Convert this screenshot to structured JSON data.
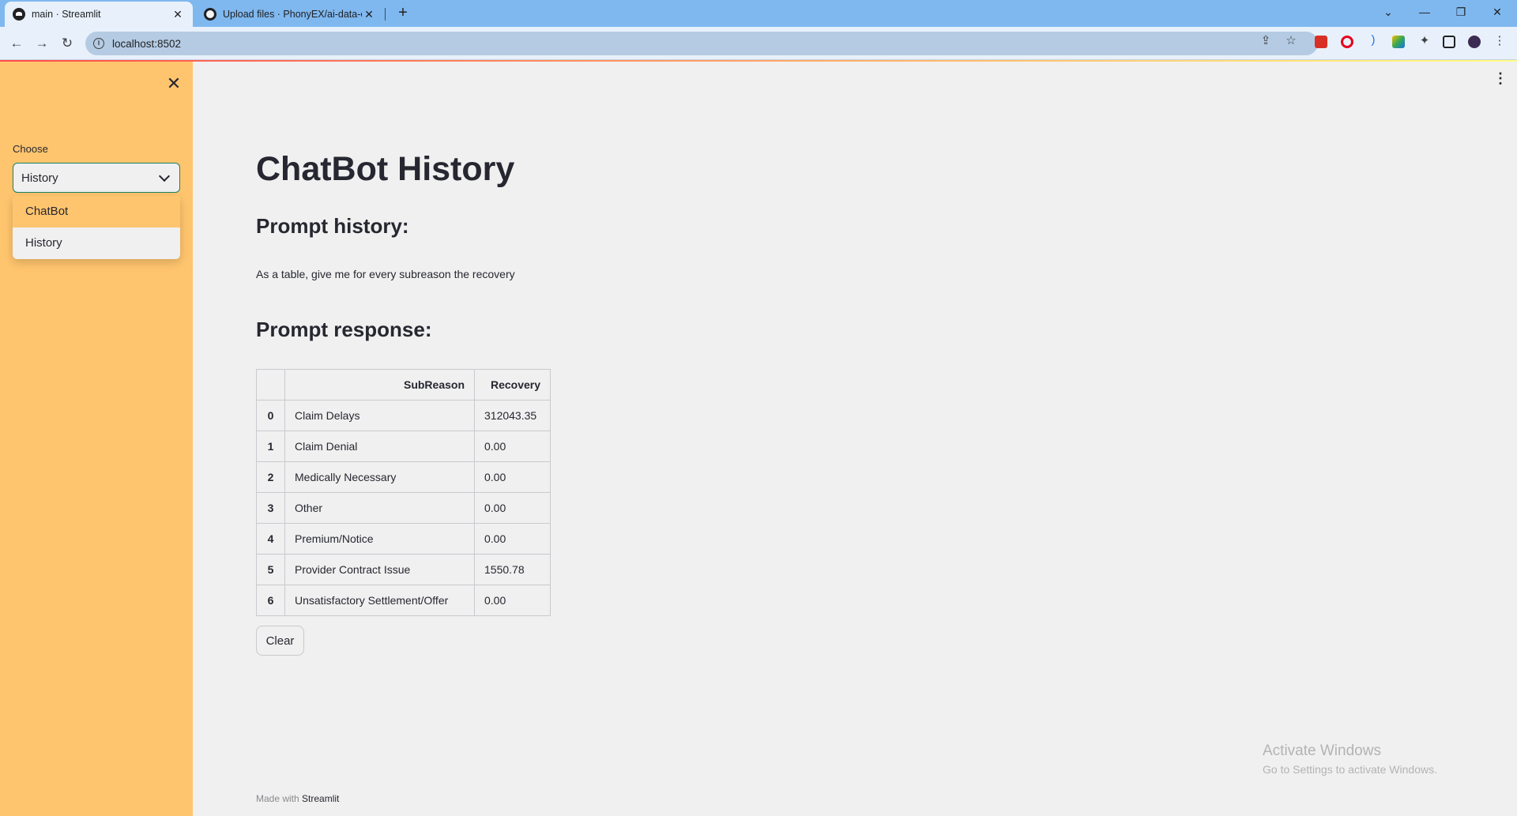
{
  "browser": {
    "tabs": [
      {
        "title": "main · Streamlit",
        "close": "✕"
      },
      {
        "title": "Upload files · PhonyEX/ai-data-cl",
        "close": "✕"
      }
    ],
    "new_tab": "+",
    "url": "localhost:8502",
    "window_controls": {
      "minimize": "—",
      "maximize": "❐",
      "close": "✕"
    },
    "icons": {
      "back": "back-arrow-icon",
      "forward": "forward-arrow-icon",
      "reload": "reload-icon",
      "share": "share-icon",
      "star": "bookmark-star-icon"
    }
  },
  "sidebar": {
    "close": "✕",
    "select_label": "Choose",
    "selected": "History",
    "options": [
      "ChatBot",
      "History"
    ],
    "bg_color": "#ffc56e"
  },
  "main": {
    "menu": "⋮",
    "title": "ChatBot History",
    "prompt_history_heading": "Prompt history:",
    "prompt_text": "As a table, give me for every subreason the recovery",
    "prompt_response_heading": "Prompt response:",
    "table": {
      "headers": [
        "",
        "SubReason",
        "Recovery"
      ],
      "rows": [
        {
          "index": "0",
          "subreason": "Claim Delays",
          "recovery": "312043.35"
        },
        {
          "index": "1",
          "subreason": "Claim Denial",
          "recovery": "0.00"
        },
        {
          "index": "2",
          "subreason": "Medically Necessary",
          "recovery": "0.00"
        },
        {
          "index": "3",
          "subreason": "Other",
          "recovery": "0.00"
        },
        {
          "index": "4",
          "subreason": "Premium/Notice",
          "recovery": "0.00"
        },
        {
          "index": "5",
          "subreason": "Provider Contract Issue",
          "recovery": "1550.78"
        },
        {
          "index": "6",
          "subreason": "Unsatisfactory Settlement/Offer",
          "recovery": "0.00"
        }
      ]
    },
    "clear_button": "Clear",
    "footer": {
      "prefix": "Made with ",
      "brand": "Streamlit"
    }
  },
  "watermark": {
    "line1": "Activate Windows",
    "line2": "Go to Settings to activate Windows."
  }
}
